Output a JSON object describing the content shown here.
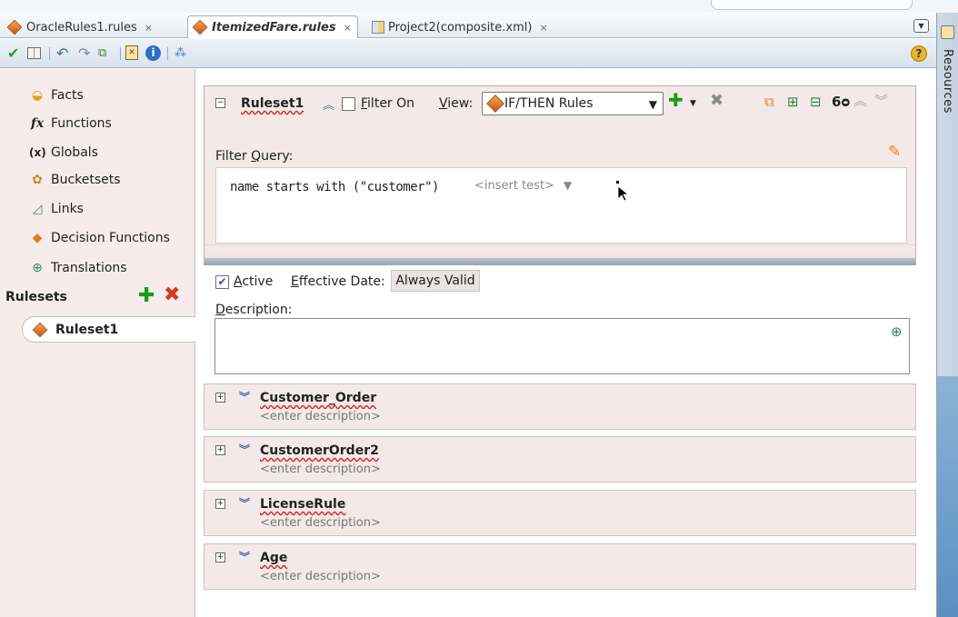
{
  "tabs": [
    {
      "label": "OracleRules1.rules",
      "close": "×",
      "active": false
    },
    {
      "label": "ItemizedFare.rules",
      "close": "×",
      "active": true
    },
    {
      "label": "Project2(composite.xml)",
      "close": "×",
      "active": false
    }
  ],
  "toolbar": {
    "icons": [
      "validate-check-icon",
      "book-icon",
      "undo-icon",
      "redo-icon",
      "decision-tree-icon",
      "report-icon",
      "info-icon",
      "test-icon"
    ],
    "help": "?"
  },
  "resources_panel": {
    "label": "Resources"
  },
  "navigator": {
    "items": [
      {
        "label": "Facts",
        "icon": "facts-icon",
        "glyph": "◒"
      },
      {
        "label": "Functions",
        "icon": "function-icon",
        "glyph": "fx"
      },
      {
        "label": "Globals",
        "icon": "globals-icon",
        "glyph": "(x)"
      },
      {
        "label": "Bucketsets",
        "icon": "bucketsets-icon",
        "glyph": "✿"
      },
      {
        "label": "Links",
        "icon": "links-icon",
        "glyph": "◿"
      },
      {
        "label": "Decision Functions",
        "icon": "decision-functions-icon",
        "glyph": "◆"
      },
      {
        "label": "Translations",
        "icon": "translations-icon",
        "glyph": "⊕"
      }
    ],
    "rulesets_heading": "Rulesets",
    "rulesets": [
      {
        "label": "Ruleset1"
      }
    ]
  },
  "ruleset": {
    "name": "Ruleset1",
    "filter_on_label": "Filter On",
    "filter_on_checked": false,
    "view_label": "View:",
    "view_value": "IF/THEN Rules",
    "filter_query_label": "Filter Query:",
    "query_text": "name starts with (\"customer\")",
    "insert_test": "<insert test>"
  },
  "active": {
    "label": "Active",
    "checked": true
  },
  "effective_date": {
    "label": "Effective Date:",
    "value": "Always Valid"
  },
  "description": {
    "label": "Description:",
    "value": ""
  },
  "rules": [
    {
      "name": "Customer_Order",
      "description": "<enter description>"
    },
    {
      "name": "CustomerOrder2",
      "description": "<enter description>"
    },
    {
      "name": "LicenseRule",
      "description": "<enter description>"
    },
    {
      "name": "Age",
      "description": "<enter description>"
    }
  ],
  "colors": {
    "accent_blue": "#4a6ea0",
    "ruleset_bg": "#f3e9e9",
    "add_green": "#1b9a1b",
    "delete_red": "#d23a1e"
  }
}
